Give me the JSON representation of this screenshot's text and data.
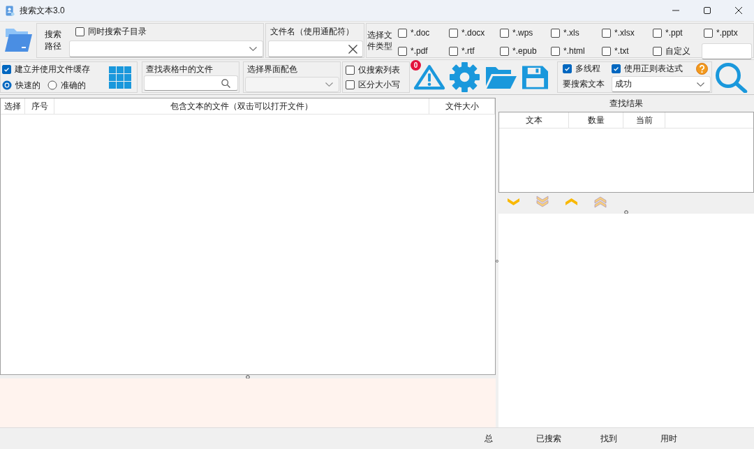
{
  "window": {
    "title": "搜索文本3.0"
  },
  "search_path": {
    "label": "搜索路径",
    "subfolders": {
      "label": "同时搜索子目录",
      "checked": false
    }
  },
  "file_name": {
    "label": "文件名（使用通配符）"
  },
  "file_types": {
    "label": "选择文件类型",
    "options": [
      {
        "label": "*.doc",
        "checked": false
      },
      {
        "label": "*.docx",
        "checked": false
      },
      {
        "label": "*.wps",
        "checked": false
      },
      {
        "label": "*.xls",
        "checked": false
      },
      {
        "label": "*.xlsx",
        "checked": false
      },
      {
        "label": "*.ppt",
        "checked": false
      },
      {
        "label": "*.pptx",
        "checked": false
      },
      {
        "label": "*.pdf",
        "checked": false
      },
      {
        "label": "*.rtf",
        "checked": false
      },
      {
        "label": "*.epub",
        "checked": false
      },
      {
        "label": "*.html",
        "checked": false
      },
      {
        "label": "*.txt",
        "checked": false
      },
      {
        "label": "自定义",
        "checked": false
      }
    ]
  },
  "file_cache": {
    "label": "建立并使用文件缓存",
    "checked": true,
    "modes": [
      {
        "label": "快速的",
        "selected": true
      },
      {
        "label": "准确的",
        "selected": false
      }
    ]
  },
  "table_search": {
    "label": "查找表格中的文件"
  },
  "color_scheme": {
    "label": "选择界面配色",
    "disabled": true
  },
  "filters": [
    {
      "label": "仅搜索列表",
      "checked": false
    },
    {
      "label": "区分大小写",
      "checked": false
    }
  ],
  "warnings": {
    "count": "0"
  },
  "search_options": {
    "multithread": {
      "label": "多线程",
      "checked": true
    },
    "regex": {
      "label": "使用正则表达式",
      "checked": true
    },
    "text": {
      "label": "要搜索文本",
      "value": "成功"
    }
  },
  "file_table": {
    "columns": [
      "选择",
      "序号",
      "包含文本的文件（双击可以打开文件）",
      "文件大小"
    ]
  },
  "results": {
    "title": "查找结果",
    "columns": [
      "文本",
      "数量",
      "当前"
    ]
  },
  "status_bar": [
    "总",
    "已搜索",
    "找到",
    "用时"
  ]
}
